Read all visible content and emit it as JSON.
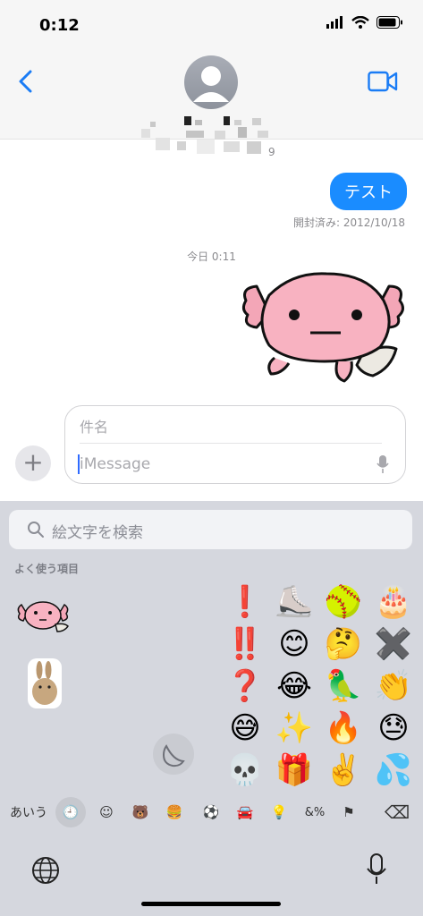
{
  "status": {
    "time": "0:12"
  },
  "header": {
    "contact_number_suffix": "9"
  },
  "chat": {
    "sent_message": "テスト",
    "read_receipt": "開封済み: 2012/10/18",
    "timestamp": "今日 0:11"
  },
  "compose": {
    "subject_placeholder": "件名",
    "message_placeholder": "iMessage",
    "plus_label": "+"
  },
  "keyboard": {
    "search_placeholder": "絵文字を検索",
    "section_title": "よく使う項目",
    "emoji_grid": [
      [
        "❗",
        "⛸️",
        "🥎",
        "🎂"
      ],
      [
        "‼️",
        "😊",
        "🤔",
        "✖️"
      ],
      [
        "❓",
        "😂",
        "🦜",
        "👏"
      ],
      [
        "😅",
        "✨",
        "🔥",
        "😓"
      ],
      [
        "💀",
        "🎁",
        "✌️",
        "💦"
      ]
    ],
    "categories": [
      "あいう",
      "🕘",
      "☺",
      "🐻",
      "🍔",
      "⚽",
      "🚘",
      "💡",
      "&%",
      "⚑",
      "⌫"
    ]
  },
  "colors": {
    "accent": "#1a8cff",
    "keyboard_bg": "#d5d7de"
  }
}
